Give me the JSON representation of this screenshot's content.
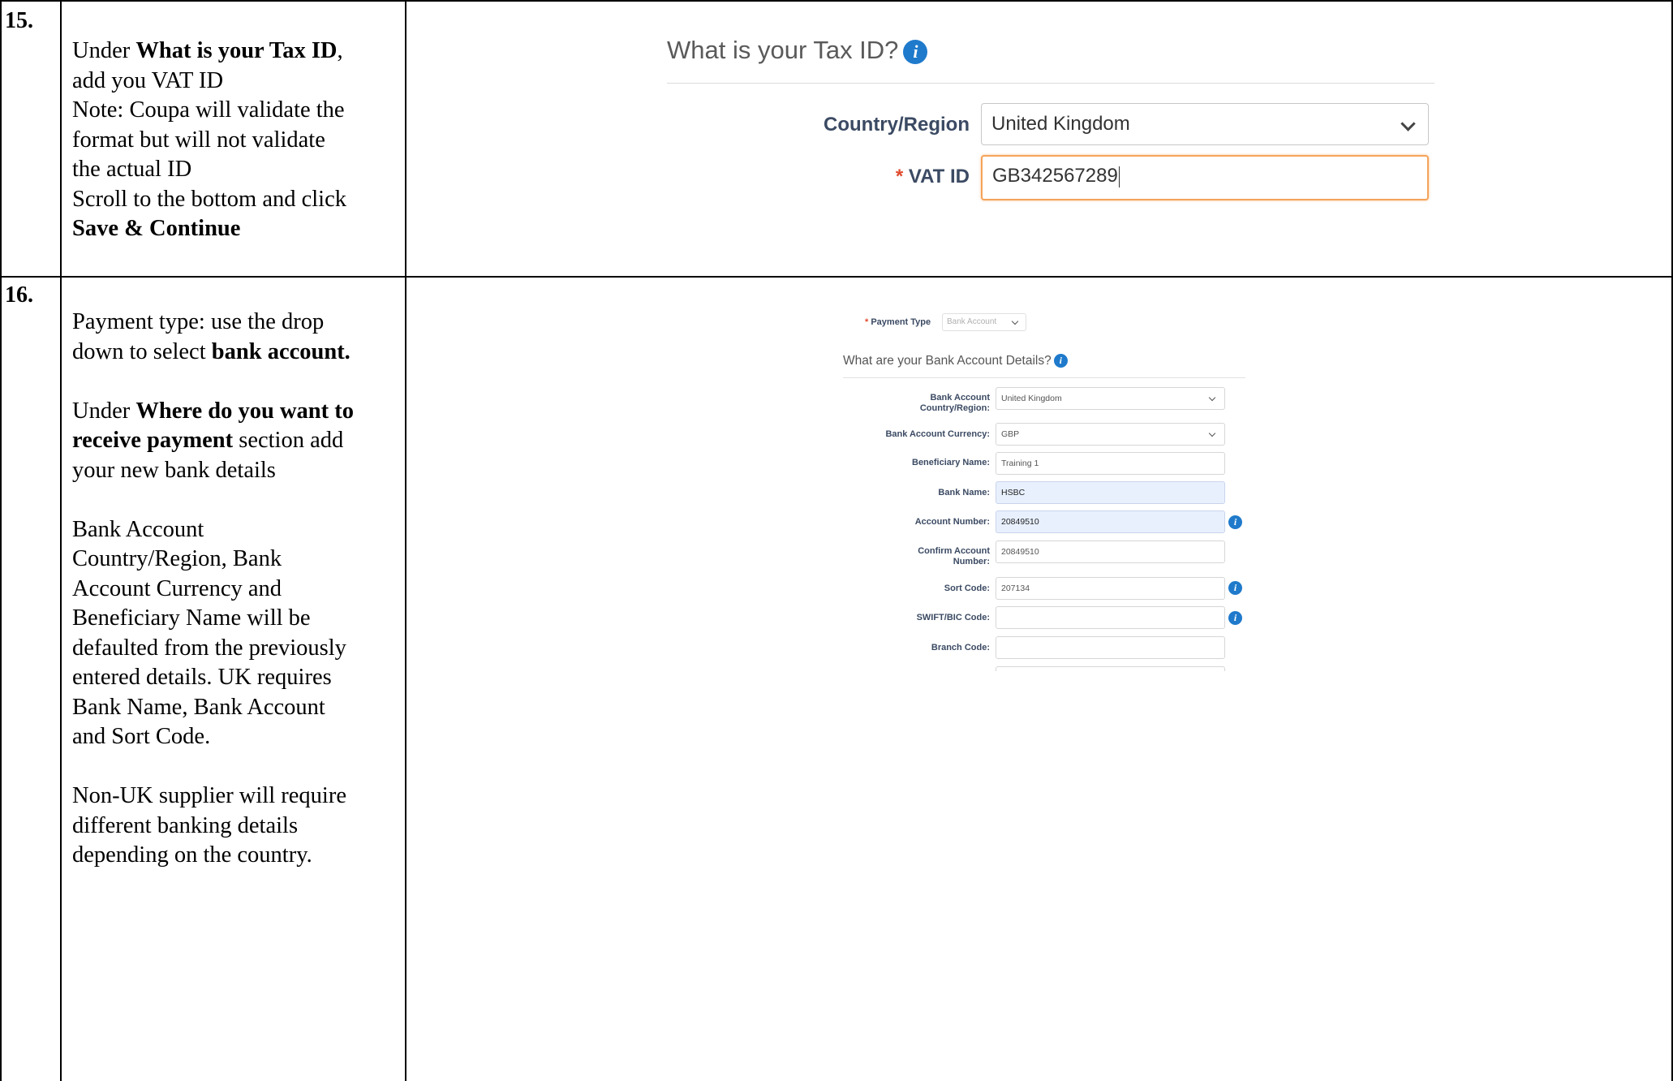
{
  "rows": [
    {
      "number": "15.",
      "instructions": {
        "l1_pre": "Under ",
        "l1_bold": "What is your Tax ID",
        "l1_post": ",",
        "l2": "add you VAT ID",
        "l3": "Note: Coupa will validate the",
        "l4": "format but will not validate",
        "l5": "the actual ID",
        "l6": "Scroll to the bottom and click",
        "l7_bold": "Save & Continue"
      },
      "screenshot": {
        "title": "What is your Tax ID?",
        "info_glyph": "i",
        "country_label": "Country/Region",
        "country_value": "United Kingdom",
        "vat_required_marker": "*",
        "vat_label": "VAT ID",
        "vat_value": "GB342567289"
      }
    },
    {
      "number": "16.",
      "instructions": {
        "p1_l1": "Payment type: use the drop",
        "p1_l2_pre": "down to select ",
        "p1_l2_bold": "bank account.",
        "p2_l1_pre": "Under ",
        "p2_l1_bold": "Where do you want to",
        "p2_l2_bold": "receive payment",
        "p2_l2_post": " section add",
        "p2_l3": "your new bank details",
        "p3_l1": "Bank Account",
        "p3_l2": "Country/Region, Bank",
        "p3_l3": "Account Currency and",
        "p3_l4": "Beneficiary Name will be",
        "p3_l5": "defaulted from the previously",
        "p3_l6": "entered details. UK requires",
        "p3_l7": "Bank Name, Bank Account",
        "p3_l8": "and Sort Code.",
        "p4_l1": "Non-UK supplier will require",
        "p4_l2": "different banking details",
        "p4_l3": "depending on the country."
      },
      "screenshot": {
        "payment_type_required_marker": "*",
        "payment_type_label": "Payment Type",
        "payment_type_value": "Bank Account",
        "bank_title": "What are your Bank Account Details?",
        "info_glyph": "i",
        "fields": {
          "country_label_1": "Bank Account",
          "country_label_2": "Country/Region:",
          "country_value": "United Kingdom",
          "currency_label": "Bank Account Currency:",
          "currency_value": "GBP",
          "beneficiary_label": "Beneficiary Name:",
          "beneficiary_value": "Training 1",
          "bank_name_label": "Bank Name:",
          "bank_name_value": "HSBC",
          "account_number_label": "Account Number:",
          "account_number_value": "20849510",
          "confirm_label_1": "Confirm Account",
          "confirm_label_2": "Number:",
          "confirm_value": "20849510",
          "sort_code_label": "Sort Code:",
          "sort_code_value": "207134",
          "swift_label": "SWIFT/BIC Code:",
          "swift_value": "",
          "branch_label": "Branch Code:",
          "branch_value": ""
        }
      }
    }
  ]
}
